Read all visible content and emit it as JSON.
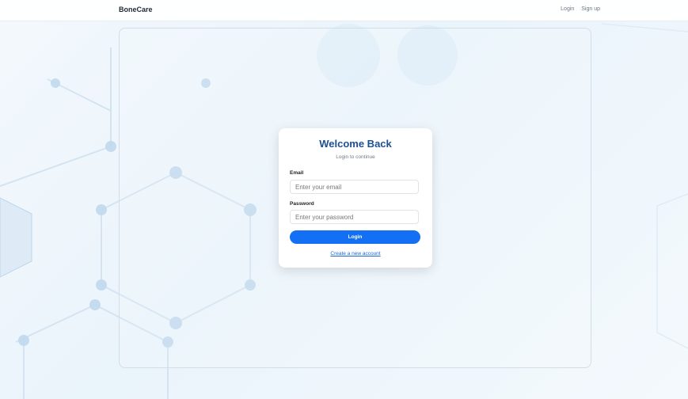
{
  "header": {
    "brand": "BoneCare",
    "nav": {
      "login": "Login",
      "signup": "Sign up"
    }
  },
  "login_card": {
    "title": "Welcome Back",
    "subtitle": "Login to continue",
    "email_label": "Email",
    "email_placeholder": "Enter your email",
    "email_value": "",
    "password_label": "Password",
    "password_placeholder": "Enter your password",
    "password_value": "",
    "login_button": "Login",
    "create_account_link": "Create a new account"
  },
  "colors": {
    "accent": "#1370f5",
    "title": "#1d4f91",
    "link": "#1a66d2"
  }
}
